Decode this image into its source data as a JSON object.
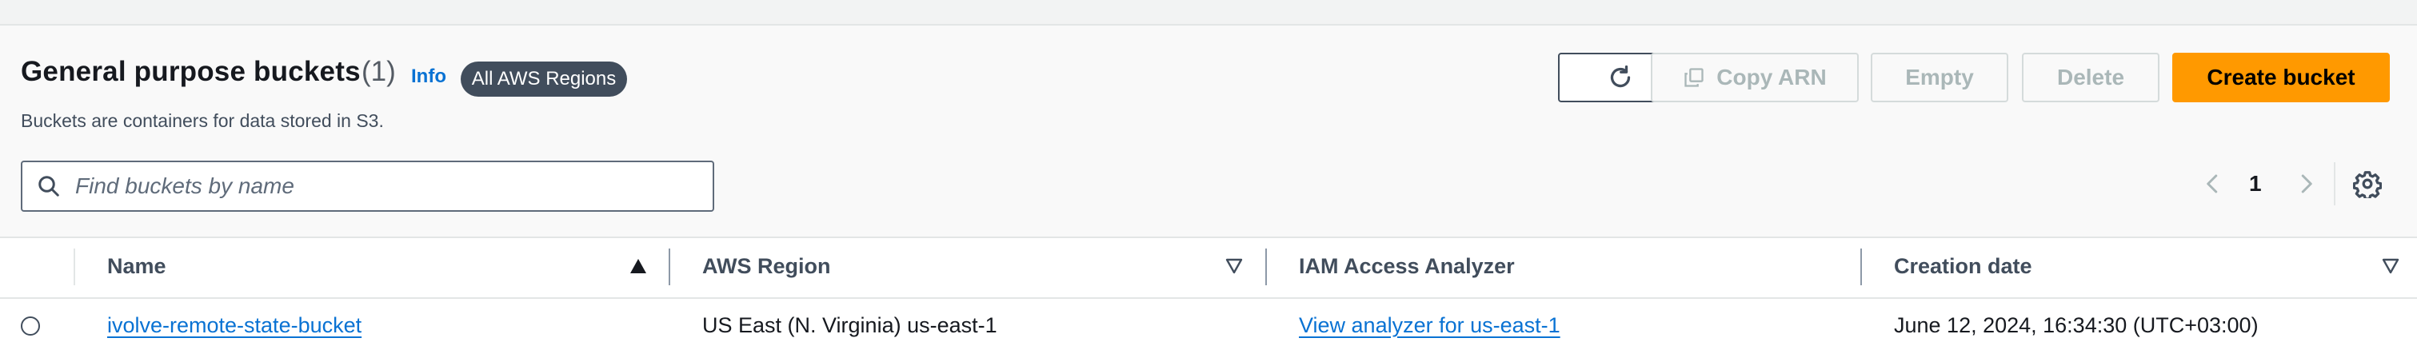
{
  "header": {
    "title": "General purpose buckets",
    "count": "(1)",
    "info_label": "Info",
    "region_badge": "All AWS Regions",
    "description": "Buckets are containers for data stored in S3."
  },
  "actions": {
    "copy_arn": "Copy ARN",
    "empty": "Empty",
    "delete": "Delete",
    "create_bucket": "Create bucket"
  },
  "search": {
    "placeholder": "Find buckets by name",
    "value": ""
  },
  "pagination": {
    "current_page": "1"
  },
  "table": {
    "columns": [
      "Name",
      "AWS Region",
      "IAM Access Analyzer",
      "Creation date"
    ],
    "rows": [
      {
        "name": "ivolve-remote-state-bucket",
        "region": "US East (N. Virginia) us-east-1",
        "analyzer": "View analyzer for us-east-1",
        "created": "June 12, 2024, 16:34:30 (UTC+03:00)"
      }
    ]
  },
  "colors": {
    "primary": "#ff9900",
    "link": "#0972d3",
    "badge": "#414d5c",
    "disabled": "#aab7b8"
  },
  "icons": [
    "refresh-icon",
    "copy-icon",
    "search-icon",
    "chevron-left-icon",
    "chevron-right-icon",
    "settings-gear-icon",
    "sort-ascending-icon",
    "sort-descending-icon"
  ]
}
